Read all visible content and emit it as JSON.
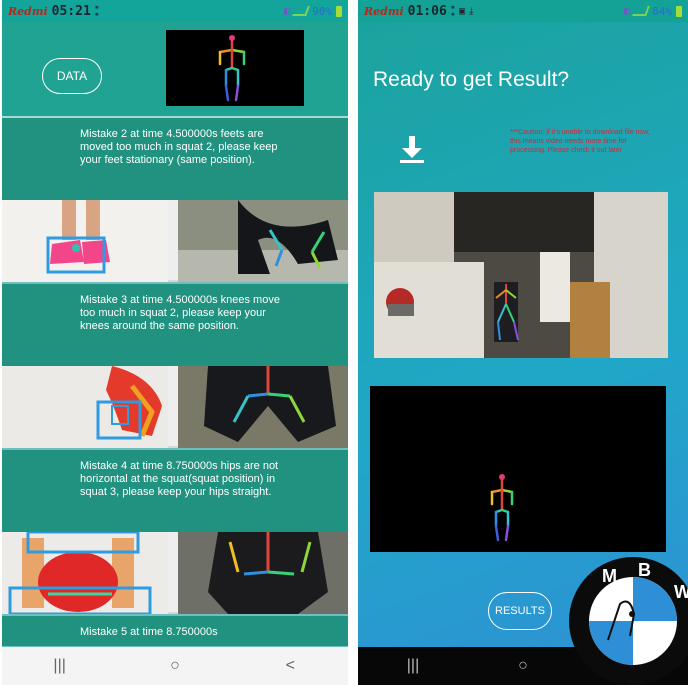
{
  "left_screen": {
    "status": {
      "carrier": "Redmi",
      "time": "05:21",
      "battery": "90%"
    },
    "data_button": "DATA",
    "mistakes": [
      {
        "text": "Mistake 2 at time 4.500000s feets are moved too much in squat 2, please keep your feet stationary (same position)."
      },
      {
        "text": "Mistake 3 at time 4.500000s knees move too much in squat 2, please keep your knees around the same position."
      },
      {
        "text": "Mistake 4 at time 8.750000s hips are not horizontal at the squat(squat position) in squat 3, please keep your hips straight."
      },
      {
        "text": "Mistake 5 at time 8.750000s"
      }
    ],
    "nav": {
      "recents": "|||",
      "home": "○",
      "back": "<"
    }
  },
  "right_screen": {
    "status": {
      "carrier": "Redmi",
      "time": "01:06",
      "battery": "84%"
    },
    "title": "Ready to get Result?",
    "caution": "***Caution: if it's unable to download file now, this means video needs more time for processing. Please check it out later",
    "results_button": "RESULTS",
    "nav": {
      "recents": "|||",
      "home": "○"
    }
  },
  "watermark": {
    "letters": [
      "M",
      "B",
      "W"
    ]
  },
  "colors": {
    "teal_dark": "#21927f",
    "teal": "#21a393",
    "gradient_end": "#2f8fd6",
    "caution_red": "#d0283c"
  }
}
